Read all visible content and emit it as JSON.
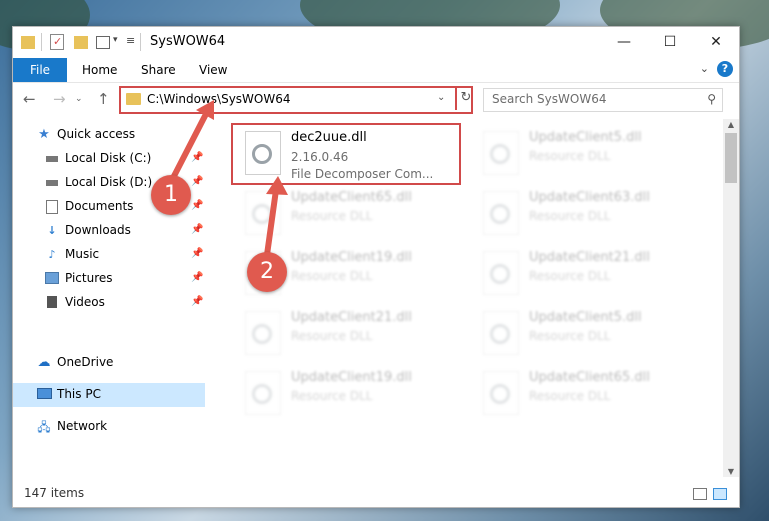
{
  "window": {
    "title": "SysWOW64",
    "controls": {
      "minimize": "—",
      "maximize": "☐",
      "close": "✕"
    }
  },
  "ribbon": {
    "tabs": [
      "File",
      "Home",
      "Share",
      "View"
    ],
    "help": "?"
  },
  "navigation": {
    "address": "C:\\Windows\\SysWOW64",
    "search_placeholder": "Search SysWOW64"
  },
  "sidebar": {
    "items": [
      {
        "label": "Quick access",
        "icon": "star-icon"
      },
      {
        "label": "Local Disk (C:)",
        "icon": "drive-icon",
        "pinned": true
      },
      {
        "label": "Local Disk (D:)",
        "icon": "drive-icon",
        "pinned": true
      },
      {
        "label": "Documents",
        "icon": "documents-icon",
        "pinned": true
      },
      {
        "label": "Downloads",
        "icon": "download-arrow-icon",
        "pinned": true
      },
      {
        "label": "Music",
        "icon": "music-note-icon",
        "pinned": true
      },
      {
        "label": "Pictures",
        "icon": "pictures-icon",
        "pinned": true
      },
      {
        "label": "Videos",
        "icon": "film-icon",
        "pinned": true
      },
      {
        "label": "OneDrive",
        "icon": "cloud-icon"
      },
      {
        "label": "This PC",
        "icon": "monitor-icon",
        "selected": true
      },
      {
        "label": "Network",
        "icon": "network-icon"
      }
    ]
  },
  "files": {
    "highlighted": {
      "name": "dec2uue.dll",
      "version": "2.16.0.46",
      "description": "File Decomposer Com..."
    },
    "others": [
      {
        "name": "UpdateClient5.dll",
        "type": "Resource DLL"
      },
      {
        "name": "UpdateClient65.dll",
        "type": "Resource DLL"
      },
      {
        "name": "UpdateClient63.dll",
        "type": "Resource DLL"
      },
      {
        "name": "UpdateClient19.dll",
        "type": "Resource DLL"
      },
      {
        "name": "UpdateClient21.dll",
        "type": "Resource DLL"
      },
      {
        "name": "UpdateClient21.dll",
        "type": "Resource DLL"
      },
      {
        "name": "UpdateClient5.dll",
        "type": "Resource DLL"
      },
      {
        "name": "UpdateClient19.dll",
        "type": "Resource DLL"
      },
      {
        "name": "UpdateClient65.dll",
        "type": "Resource DLL"
      }
    ]
  },
  "status": {
    "item_count": "147 items"
  },
  "callouts": [
    "1",
    "2"
  ],
  "colors": {
    "accent": "#1979ca",
    "callout": "#e05a4f",
    "highlight_border": "#d14a4a",
    "selected_bg": "#cce8ff"
  }
}
